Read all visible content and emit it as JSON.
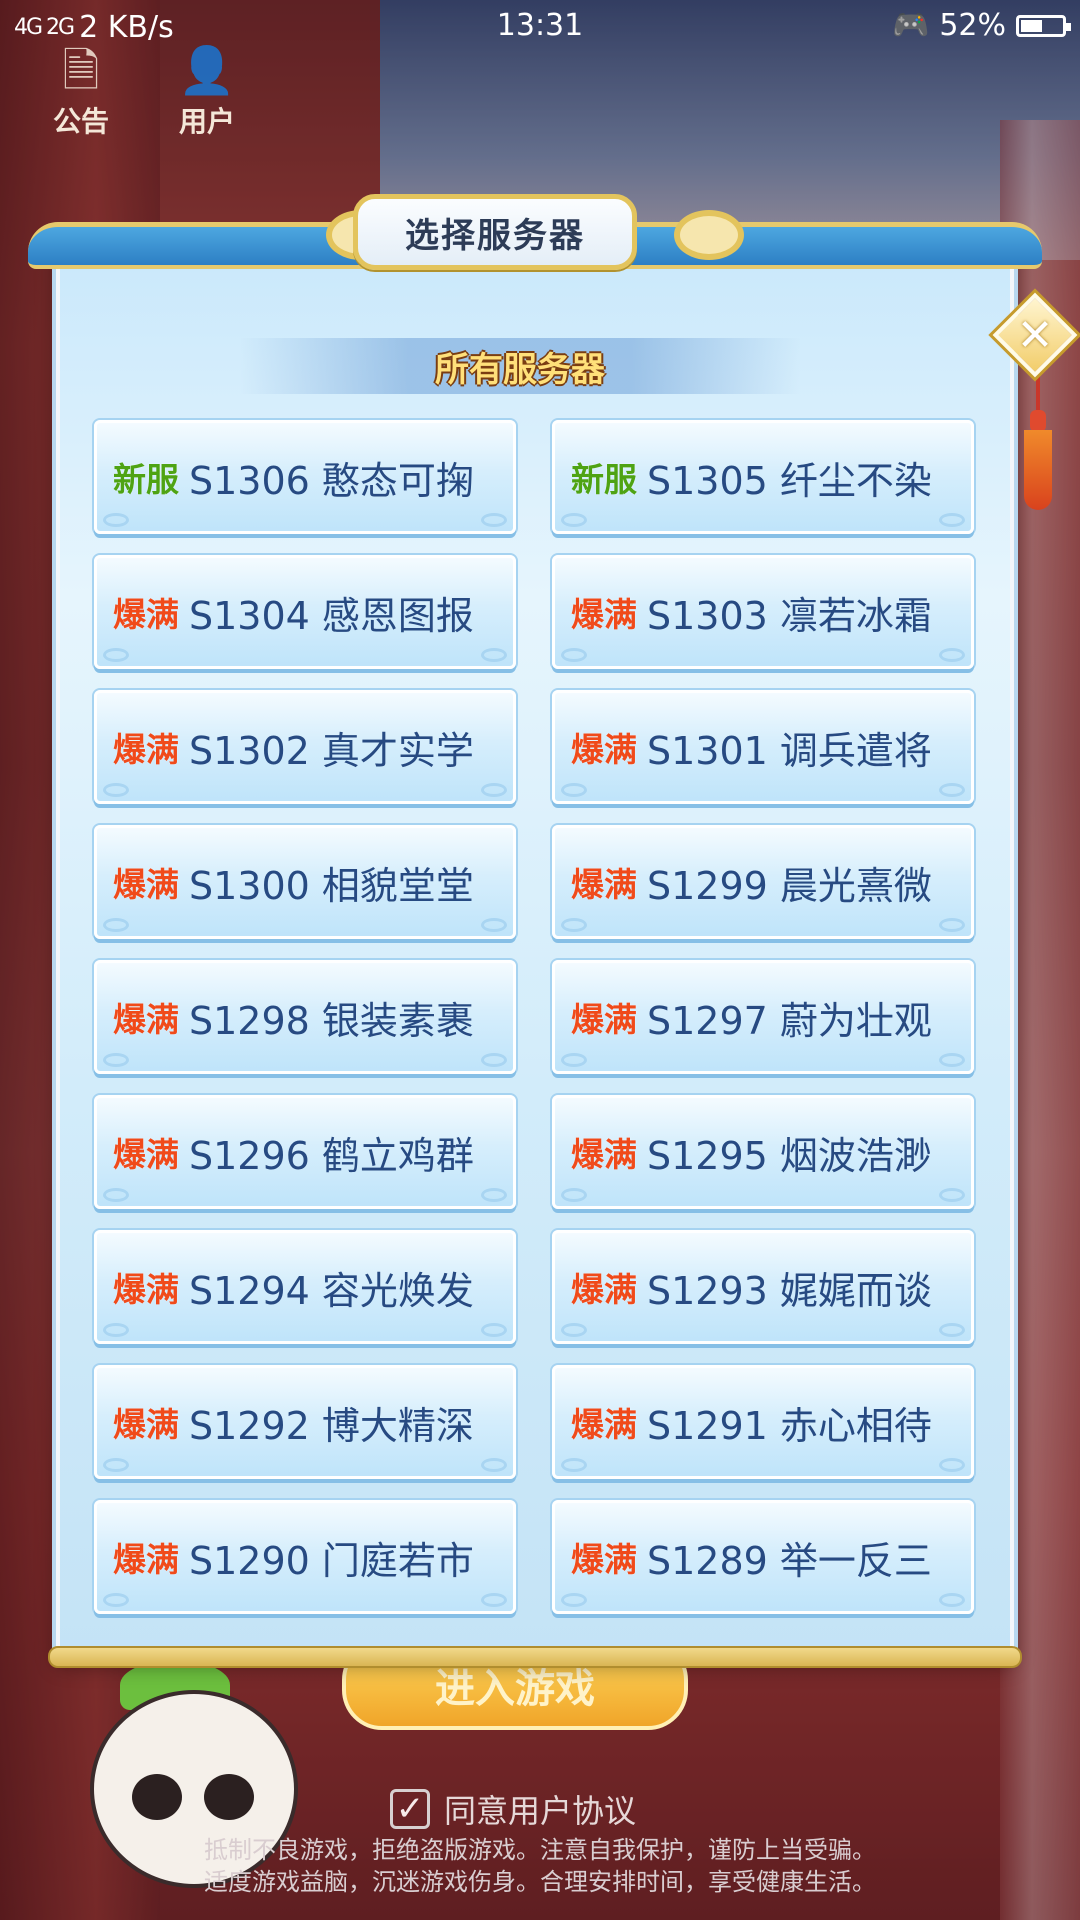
{
  "status_bar": {
    "signal": "4G 2G",
    "net_speed": "2 KB/s",
    "time": "13:31",
    "battery": "52%",
    "battery_level": 0.52
  },
  "corner": {
    "notice_label": "公告",
    "user_label": "用户"
  },
  "dialog": {
    "title": "选择服务器",
    "section_title": "所有服务器",
    "close_icon": "close-icon"
  },
  "servers": [
    {
      "tag": "新服",
      "tag_type": "new",
      "name": "S1306 憨态可掬"
    },
    {
      "tag": "新服",
      "tag_type": "new",
      "name": "S1305 纤尘不染"
    },
    {
      "tag": "爆满",
      "tag_type": "full",
      "name": "S1304 感恩图报"
    },
    {
      "tag": "爆满",
      "tag_type": "full",
      "name": "S1303 凛若冰霜"
    },
    {
      "tag": "爆满",
      "tag_type": "full",
      "name": "S1302 真才实学"
    },
    {
      "tag": "爆满",
      "tag_type": "full",
      "name": "S1301 调兵遣将"
    },
    {
      "tag": "爆满",
      "tag_type": "full",
      "name": "S1300 相貌堂堂"
    },
    {
      "tag": "爆满",
      "tag_type": "full",
      "name": "S1299 晨光熹微"
    },
    {
      "tag": "爆满",
      "tag_type": "full",
      "name": "S1298 银装素裹"
    },
    {
      "tag": "爆满",
      "tag_type": "full",
      "name": "S1297 蔚为壮观"
    },
    {
      "tag": "爆满",
      "tag_type": "full",
      "name": "S1296 鹤立鸡群"
    },
    {
      "tag": "爆满",
      "tag_type": "full",
      "name": "S1295 烟波浩渺"
    },
    {
      "tag": "爆满",
      "tag_type": "full",
      "name": "S1294 容光焕发"
    },
    {
      "tag": "爆满",
      "tag_type": "full",
      "name": "S1293 娓娓而谈"
    },
    {
      "tag": "爆满",
      "tag_type": "full",
      "name": "S1292 博大精深"
    },
    {
      "tag": "爆满",
      "tag_type": "full",
      "name": "S1291 赤心相待"
    },
    {
      "tag": "爆满",
      "tag_type": "full",
      "name": "S1290 门庭若市"
    },
    {
      "tag": "爆满",
      "tag_type": "full",
      "name": "S1289 举一反三"
    }
  ],
  "footer": {
    "enter_label": "进入游戏",
    "agree_label": "同意用户协议",
    "agree_checked": true,
    "notice_line1": "抵制不良游戏，拒绝盗版游戏。注意自我保护，谨防上当受骗。",
    "notice_line2": "适度游戏益脑，沉迷游戏伤身。合理安排时间，享受健康生活。"
  },
  "colors": {
    "tag_new": "#4ea313",
    "tag_full": "#f04a1a",
    "server_name": "#274a82",
    "section_title": "#ffe07a",
    "frame_gold": "#e3c45d"
  }
}
